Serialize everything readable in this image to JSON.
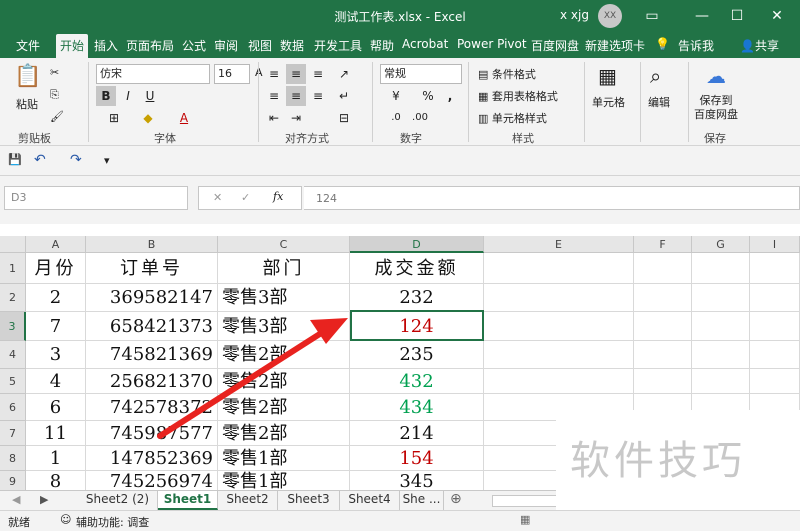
{
  "window": {
    "title": "测试工作表.xlsx  -  Excel",
    "user_name": "x xjg",
    "avatar_initials": "XX",
    "controls": [
      "▭",
      "—",
      "☐",
      "✕"
    ]
  },
  "ribbon_tabs": [
    "文件",
    "开始",
    "插入",
    "页面布局",
    "公式",
    "审阅",
    "视图",
    "数据",
    "开发工具",
    "帮助",
    "Acrobat",
    "Power Pivot",
    "百度网盘",
    "新建选项卡",
    "告诉我",
    "共享"
  ],
  "active_tab": "开始",
  "ribbon": {
    "clipboard": {
      "label": "剪贴板",
      "paste": "粘贴"
    },
    "font": {
      "label": "字体",
      "font_name": "仿宋",
      "font_size": "16",
      "bold": "B",
      "italic": "I",
      "underline": "U"
    },
    "alignment": {
      "label": "对齐方式"
    },
    "number": {
      "label": "数字",
      "format": "常规",
      "percent": "%",
      "comma": ","
    },
    "styles": {
      "label": "样式",
      "conditional": "条件格式",
      "table": "套用表格格式",
      "cell_styles": "单元格样式"
    },
    "cells": {
      "label": "单元格"
    },
    "editing": {
      "label": "编辑"
    },
    "save": {
      "label": "保存",
      "button": "保存到\n百度网盘"
    }
  },
  "formula_bar": {
    "name_box": "D3",
    "cancel": "✕",
    "enter": "✓",
    "fx": "fx",
    "value": "124"
  },
  "columns": [
    "A",
    "B",
    "C",
    "D",
    "E",
    "F",
    "G",
    "I"
  ],
  "rows": [
    {
      "num": "1",
      "a": "月份",
      "b": "订单号",
      "c": "部门",
      "d": "成交金额"
    },
    {
      "num": "2",
      "a": "2",
      "b": "369582147",
      "c": "零售3部",
      "d": "232"
    },
    {
      "num": "3",
      "a": "7",
      "b": "658421373",
      "c": "零售3部",
      "d": "124"
    },
    {
      "num": "4",
      "a": "3",
      "b": "745821369",
      "c": "零售2部",
      "d": "235"
    },
    {
      "num": "5",
      "a": "4",
      "b": "256821370",
      "c": "零售2部",
      "d": "432"
    },
    {
      "num": "6",
      "a": "6",
      "b": "742578372",
      "c": "零售2部",
      "d": "434"
    },
    {
      "num": "7",
      "a": "11",
      "b": "745987577",
      "c": "零售2部",
      "d": "214"
    },
    {
      "num": "8",
      "a": "1",
      "b": "147852369",
      "c": "零售1部",
      "d": "154"
    },
    {
      "num": "9",
      "a": "8",
      "b": "745256974",
      "c": "零售1部",
      "d": "345"
    }
  ],
  "d_colors": {
    "124": "#c00000",
    "154": "#c00000",
    "432": "#00a050",
    "434": "#00a050"
  },
  "sheets": [
    "Sheet2 (2)",
    "Sheet1",
    "Sheet2",
    "Sheet3",
    "Sheet4",
    "She ..."
  ],
  "active_sheet": "Sheet1",
  "status": {
    "ready": "就绪",
    "accessibility": "辅助功能: 调查"
  },
  "watermark": "软件技巧"
}
